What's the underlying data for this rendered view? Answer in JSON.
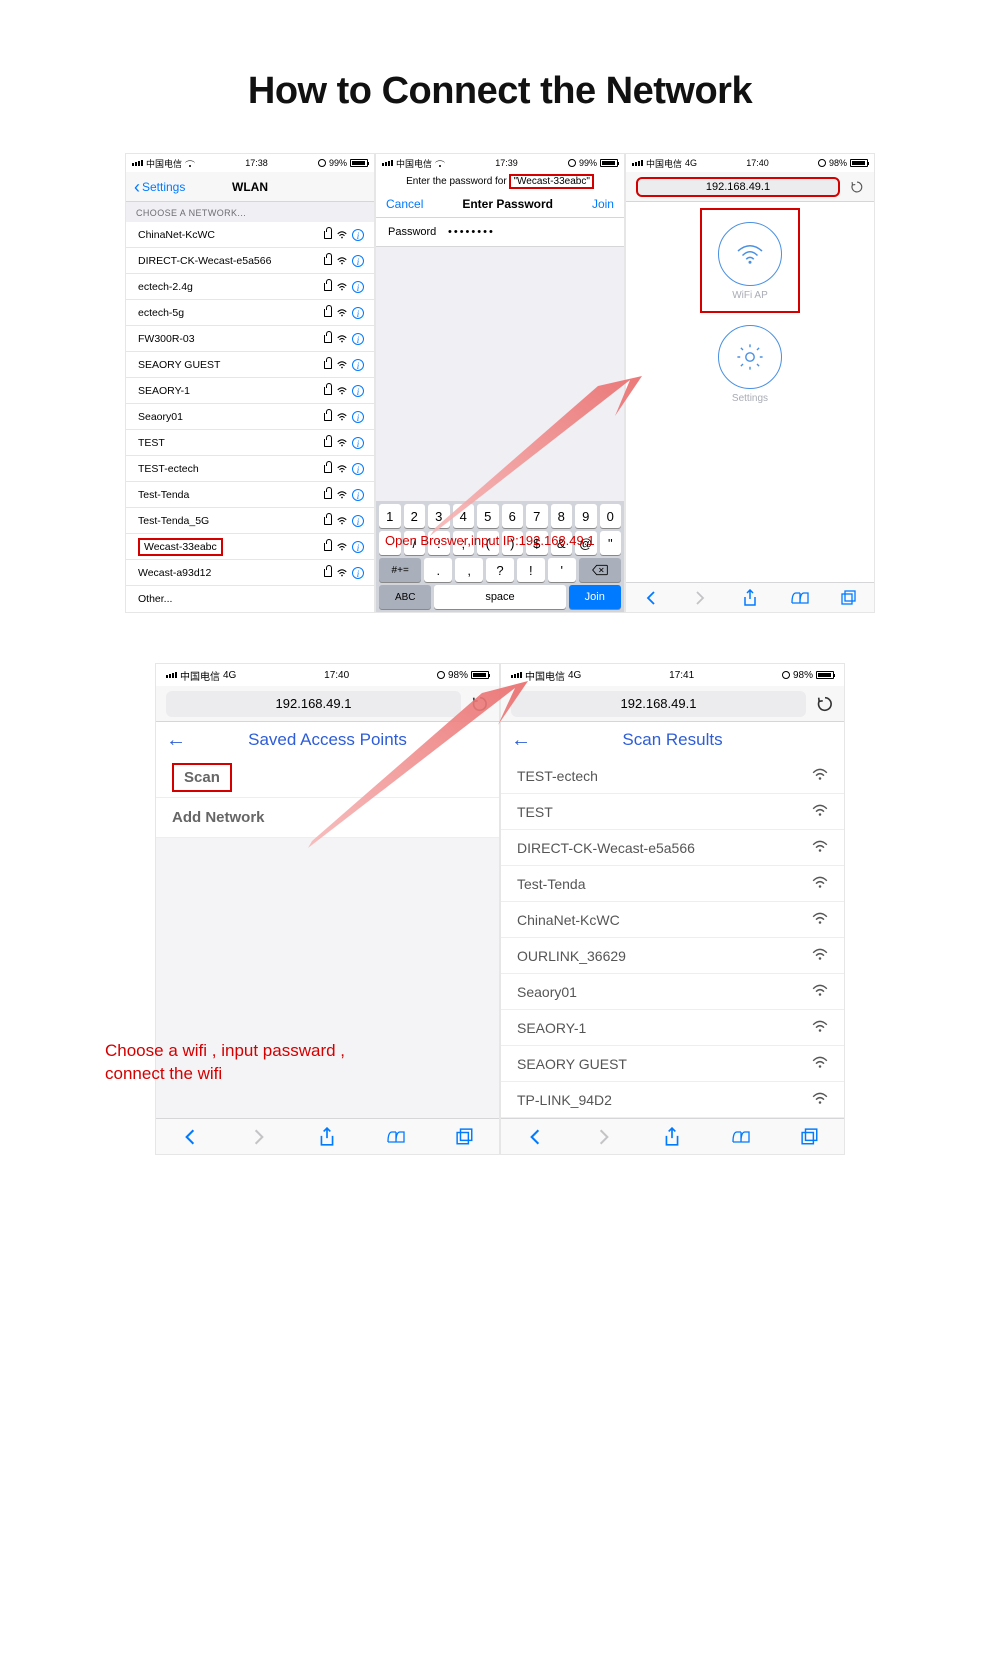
{
  "title": "How to Connect the Network",
  "screen1": {
    "carrier": "中国电信",
    "time": "17:38",
    "battery": "99%",
    "nav_back": "Settings",
    "nav_title": "WLAN",
    "section": "CHOOSE A NETWORK...",
    "networks": [
      "ChinaNet-KcWC",
      "DIRECT-CK-Wecast-e5a566",
      "ectech-2.4g",
      "ectech-5g",
      "FW300R-03",
      "SEAORY GUEST",
      "SEAORY-1",
      "Seaory01",
      "TEST",
      "TEST-ectech",
      "Test-Tenda",
      "Test-Tenda_5G",
      "Wecast-33eabc",
      "Wecast-a93d12"
    ],
    "highlighted_index": 12,
    "other": "Other..."
  },
  "screen2": {
    "carrier": "中国电信",
    "time": "17:39",
    "battery": "99%",
    "prompt_pre": "Enter the password for ",
    "prompt_ssid": "\"Wecast-33eabc\"",
    "cancel": "Cancel",
    "title": "Enter Password",
    "join": "Join",
    "pw_label": "Password",
    "pw_value": "••••••••",
    "kbd_row1": [
      "1",
      "2",
      "3",
      "4",
      "5",
      "6",
      "7",
      "8",
      "9",
      "0"
    ],
    "kbd_row2": [
      "-",
      "/",
      ":",
      ";",
      "(",
      ")",
      "$",
      "&",
      "@",
      "\""
    ],
    "kbd_row3_shift": "#+=",
    "kbd_row3": [
      ".",
      ",",
      "?",
      "!",
      "'"
    ],
    "kbd_abc": "ABC",
    "kbd_space": "space",
    "kbd_join": "Join"
  },
  "screen3": {
    "carrier": "中国电信",
    "nettype": "4G",
    "time": "17:40",
    "battery": "98%",
    "url": "192.168.49.1",
    "wifi_ap": "WiFi AP",
    "settings": "Settings"
  },
  "annotation1": "Open Broswer,input IP:192.168.49.1",
  "screen4": {
    "carrier": "中国电信",
    "nettype": "4G",
    "time": "17:40",
    "battery": "98%",
    "url": "192.168.49.1",
    "page_title": "Saved Access Points",
    "scan": "Scan",
    "add": "Add Network"
  },
  "screen5": {
    "carrier": "中国电信",
    "nettype": "4G",
    "time": "17:41",
    "battery": "98%",
    "url": "192.168.49.1",
    "page_title": "Scan Results",
    "results": [
      "TEST-ectech",
      "TEST",
      "DIRECT-CK-Wecast-e5a566",
      "Test-Tenda",
      "ChinaNet-KcWC",
      "OURLINK_36629",
      "Seaory01",
      "SEAORY-1",
      "SEAORY GUEST",
      "TP-LINK_94D2"
    ]
  },
  "annotation2": "Choose a wifi , input passward , connect the wifi"
}
